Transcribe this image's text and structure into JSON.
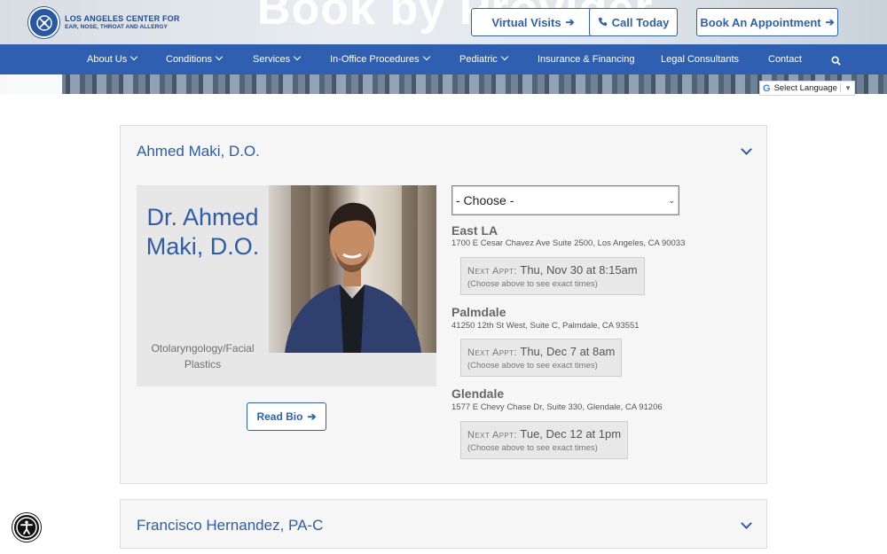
{
  "header": {
    "hero_title": "Book by Provider",
    "logo": {
      "line1": "LOS ANGELES CENTER FOR",
      "line2": "EAR, NOSE, THROAT AND ALLERGY"
    },
    "buttons": [
      {
        "label": "Virtual Visits",
        "icon": "arrow-right-icon"
      },
      {
        "label": "Call Today",
        "icon": "phone-icon"
      },
      {
        "label": "Book An Appointment",
        "icon": "arrow-right-icon"
      }
    ],
    "translate": {
      "label": "Select Language"
    }
  },
  "nav": {
    "items": [
      {
        "label": "About Us",
        "dropdown": true
      },
      {
        "label": "Conditions",
        "dropdown": true
      },
      {
        "label": "Services",
        "dropdown": true
      },
      {
        "label": "In-Office Procedures",
        "dropdown": true
      },
      {
        "label": "Pediatric",
        "dropdown": true
      },
      {
        "label": "Insurance & Financing",
        "dropdown": false
      },
      {
        "label": "Legal Consultants",
        "dropdown": false
      },
      {
        "label": "Contact",
        "dropdown": false
      }
    ],
    "search_icon": "search-icon"
  },
  "providers": [
    {
      "name": "Ahmed Maki, D.O.",
      "card_name": "Dr. Ahmed Maki, D.O.",
      "specialty": "Otolaryngology/Facial Plastics",
      "read_bio": "Read Bio",
      "select": {
        "value": "- Choose -"
      },
      "locations": [
        {
          "name": "East LA",
          "address": "1700 E Cesar Chavez Ave Suite 2500, Los Angeles, CA 90033",
          "next_label": "Next Appt",
          "next_time": "Thu, Nov 30 at 8:15am",
          "note": "(Choose above to see exact times)"
        },
        {
          "name": "Palmdale",
          "address": "41250 12th St West, Suite C, Palmdale, CA 93551",
          "next_label": "Next Appt",
          "next_time": "Thu, Dec 7 at 8am",
          "note": "(Choose above to see exact times)"
        },
        {
          "name": "Glendale",
          "address": "1577 E Chevy Chase Dr, Suite 330, Glendale, CA 91206",
          "next_label": "Next Appt",
          "next_time": "Tue, Dec 12 at 1pm",
          "note": "(Choose above to see exact times)"
        }
      ]
    },
    {
      "name": "Francisco Hernandez, PA-C"
    }
  ],
  "accessibility": {
    "icon": "accessibility-icon"
  },
  "colors": {
    "brand": "#2f5fb0",
    "link": "#2d5ca8",
    "panel_bg": "#f6f6f6"
  }
}
